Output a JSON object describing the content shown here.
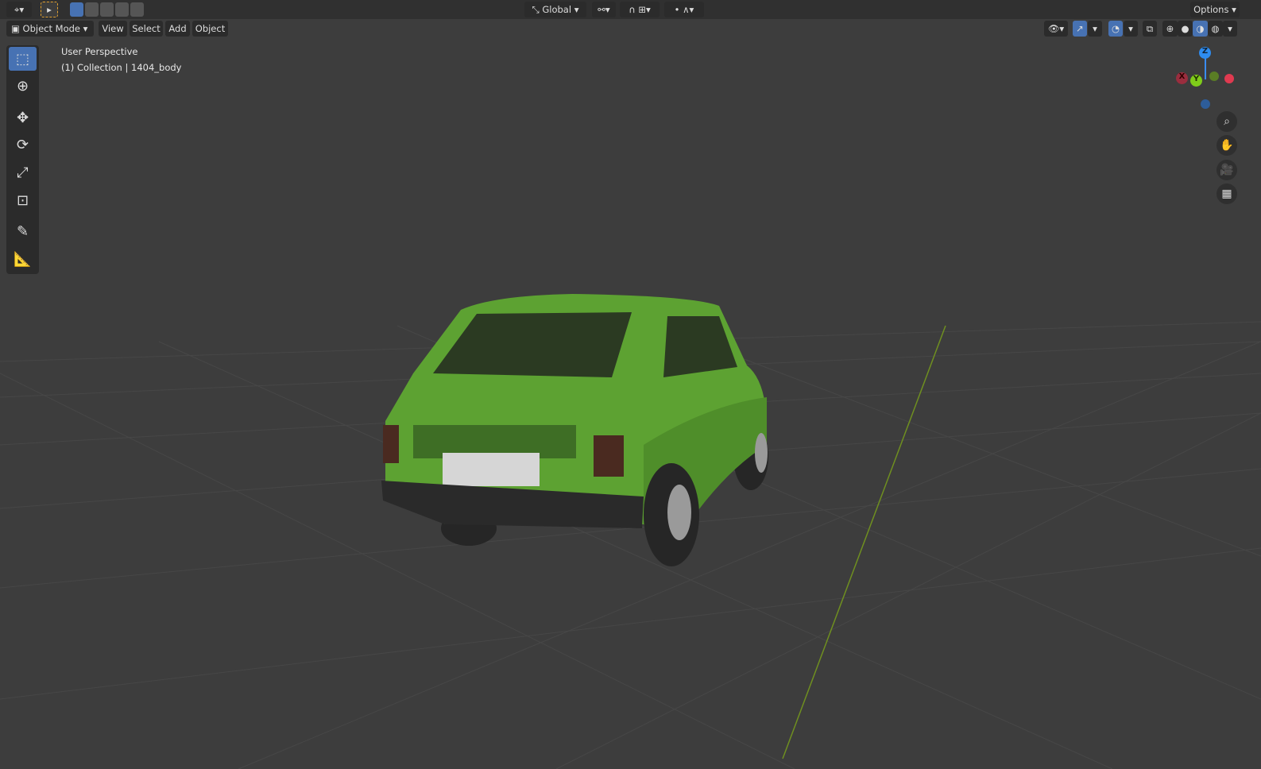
{
  "top_bar": {
    "orientation": "Global",
    "options_label": "Options"
  },
  "header": {
    "mode": "Object Mode",
    "menus": [
      "View",
      "Select",
      "Add",
      "Object"
    ]
  },
  "overlay": {
    "view_name": "User Perspective",
    "collection_info": "(1) Collection | 1404_body"
  },
  "gizmo": {
    "x": "X",
    "y": "Y",
    "z": "Z"
  },
  "colors": {
    "background": "#3d3d3d",
    "accent": "#4772b3",
    "car": "#5da232",
    "y_axis": "#6f8f20"
  }
}
